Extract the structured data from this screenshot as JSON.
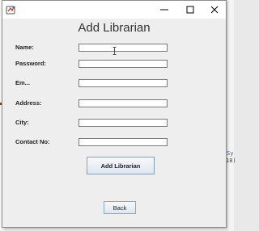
{
  "window": {
    "title": ""
  },
  "form": {
    "heading": "Add Librarian",
    "fields": [
      {
        "label": "Name:",
        "value": ""
      },
      {
        "label": "Password:",
        "value": ""
      },
      {
        "label": "Em...",
        "value": ""
      },
      {
        "label": "Address:",
        "value": ""
      },
      {
        "label": "City:",
        "value": ""
      },
      {
        "label": "Contact No:",
        "value": ""
      }
    ],
    "submit_label": "Add Librarian",
    "back_label": "Back"
  },
  "background": {
    "code_snippet_1": "Sy",
    "code_snippet_2": "18)"
  },
  "icons": {
    "app": "java-app-icon",
    "minimize": "minimize-icon",
    "maximize": "maximize-icon",
    "close": "close-icon",
    "cursor": "text-cursor-icon"
  }
}
